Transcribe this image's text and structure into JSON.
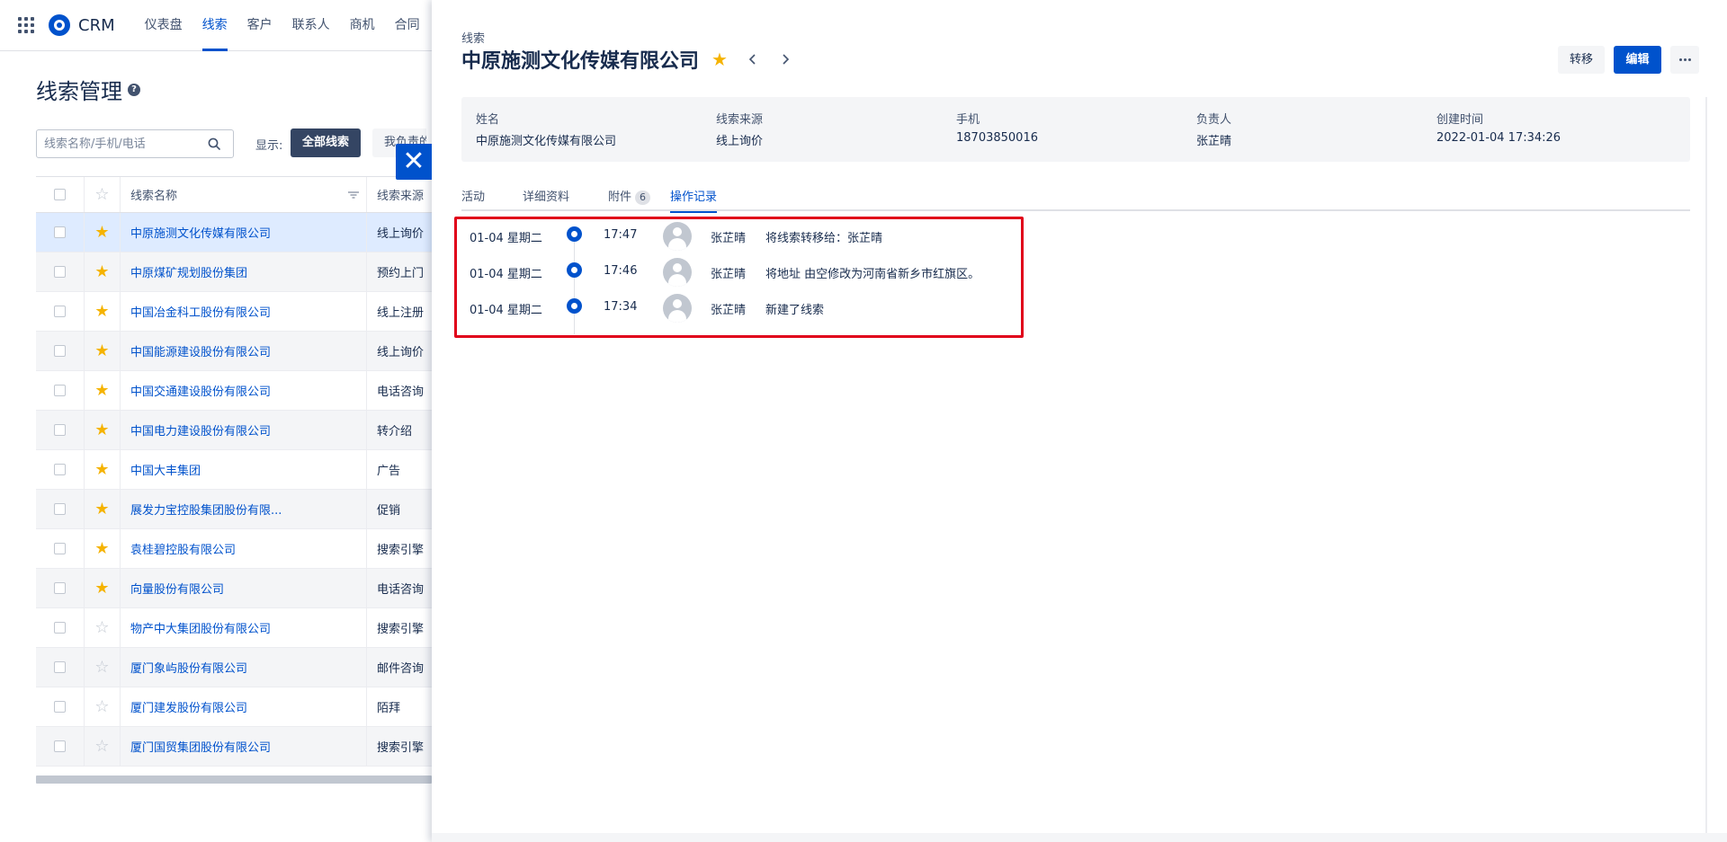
{
  "app": {
    "name": "CRM"
  },
  "nav": [
    {
      "label": "仪表盘",
      "active": false
    },
    {
      "label": "线索",
      "active": true
    },
    {
      "label": "客户",
      "active": false
    },
    {
      "label": "联系人",
      "active": false
    },
    {
      "label": "商机",
      "active": false
    },
    {
      "label": "合同",
      "active": false
    }
  ],
  "list_page": {
    "title": "线索管理",
    "search_placeholder": "线索名称/手机/电话",
    "show_label": "显示:",
    "filter_all": "全部线索",
    "filter_mine": "我负责的",
    "columns": {
      "name": "线索名称",
      "source": "线索来源"
    },
    "rows": [
      {
        "name": "中原施测文化传媒有限公司",
        "source": "线上询价",
        "starred": true
      },
      {
        "name": "中原煤矿规划股份集团",
        "source": "预约上门",
        "starred": true
      },
      {
        "name": "中国冶金科工股份有限公司",
        "source": "线上注册",
        "starred": true
      },
      {
        "name": "中国能源建设股份有限公司",
        "source": "线上询价",
        "starred": true
      },
      {
        "name": "中国交通建设股份有限公司",
        "source": "电话咨询",
        "starred": true
      },
      {
        "name": "中国电力建设股份有限公司",
        "source": "转介绍",
        "starred": true
      },
      {
        "name": "中国大丰集团",
        "source": "广告",
        "starred": true
      },
      {
        "name": "展发力宝控股集团股份有限...",
        "source": "促销",
        "starred": true
      },
      {
        "name": "袁桂碧控股有限公司",
        "source": "搜索引擎",
        "starred": true
      },
      {
        "name": "向量股份有限公司",
        "source": "电话咨询",
        "starred": true
      },
      {
        "name": "物产中大集团股份有限公司",
        "source": "搜索引擎",
        "starred": false
      },
      {
        "name": "厦门象屿股份有限公司",
        "source": "邮件咨询",
        "starred": false
      },
      {
        "name": "厦门建发股份有限公司",
        "source": "陌拜",
        "starred": false
      },
      {
        "name": "厦门国贸集团股份有限公司",
        "source": "搜索引擎",
        "starred": false
      }
    ]
  },
  "drawer": {
    "breadcrumb": "线索",
    "title": "中原施测文化传媒有限公司",
    "actions": {
      "transfer": "转移",
      "edit": "编辑"
    },
    "info": [
      {
        "label": "姓名",
        "value": "中原施测文化传媒有限公司"
      },
      {
        "label": "线索来源",
        "value": "线上询价"
      },
      {
        "label": "手机",
        "value": "18703850016"
      },
      {
        "label": "负责人",
        "value": "张芷晴"
      },
      {
        "label": "创建时间",
        "value": "2022-01-04 17:34:26"
      }
    ],
    "tabs": [
      {
        "label": "活动"
      },
      {
        "label": "详细资料"
      },
      {
        "label": "附件",
        "badge": "6"
      },
      {
        "label": "操作记录",
        "active": true
      }
    ],
    "logs": [
      {
        "date": "01-04 星期二",
        "time": "17:47",
        "user": "张芷晴",
        "text": "将线索转移给：张芷晴"
      },
      {
        "date": "01-04 星期二",
        "time": "17:46",
        "user": "张芷晴",
        "text": "将地址 由空修改为河南省新乡市红旗区。"
      },
      {
        "date": "01-04 星期二",
        "time": "17:34",
        "user": "张芷晴",
        "text": "新建了线索"
      }
    ]
  },
  "colors": {
    "primary": "#0052cc",
    "star": "#f5b300",
    "highlight": "#e0001a",
    "dark_button": "#344563"
  }
}
